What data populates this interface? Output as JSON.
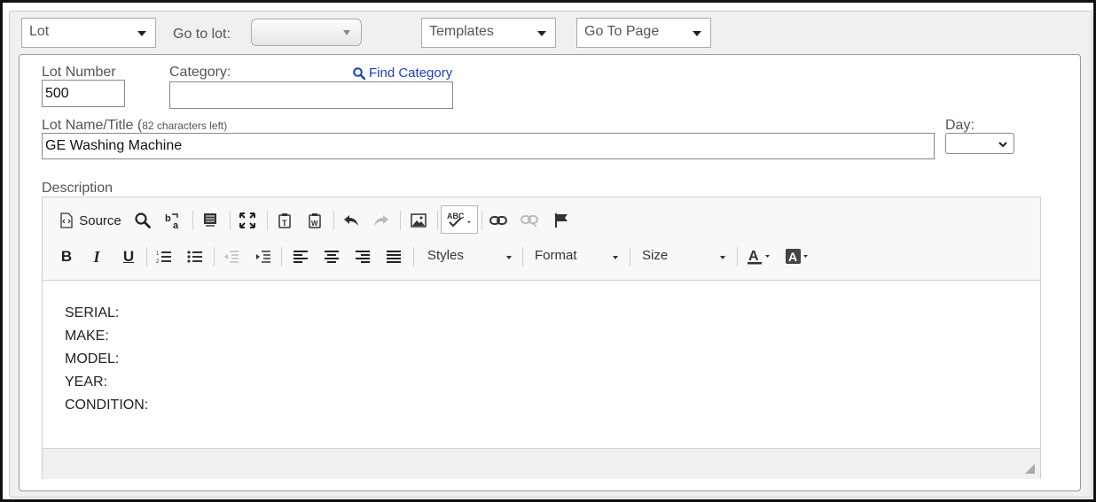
{
  "top_bar": {
    "lot_dropdown": "Lot",
    "goto_label": "Go to lot:",
    "goto_value": "",
    "templates_dropdown": "Templates",
    "goto_page_dropdown": "Go To Page"
  },
  "form": {
    "lot_number_label": "Lot Number",
    "lot_number_value": "500",
    "category_label": "Category:",
    "category_value": "",
    "find_category_label": "Find Category",
    "lot_name_label": "Lot Name/Title (",
    "chars_left": "82 characters left)",
    "lot_name_value": "GE Washing Machine",
    "day_label": "Day:",
    "day_value": "",
    "description_label": "Description"
  },
  "editor": {
    "source_label": "Source",
    "styles_label": "Styles",
    "format_label": "Format",
    "size_label": "Size",
    "content_lines": [
      "SERIAL:",
      "MAKE:",
      "MODEL:",
      "YEAR:",
      "CONDITION:"
    ]
  },
  "colors": {
    "link_blue": "#1a3ec9",
    "panel_bg": "#f0f0f0",
    "border": "#9a9a9a"
  }
}
